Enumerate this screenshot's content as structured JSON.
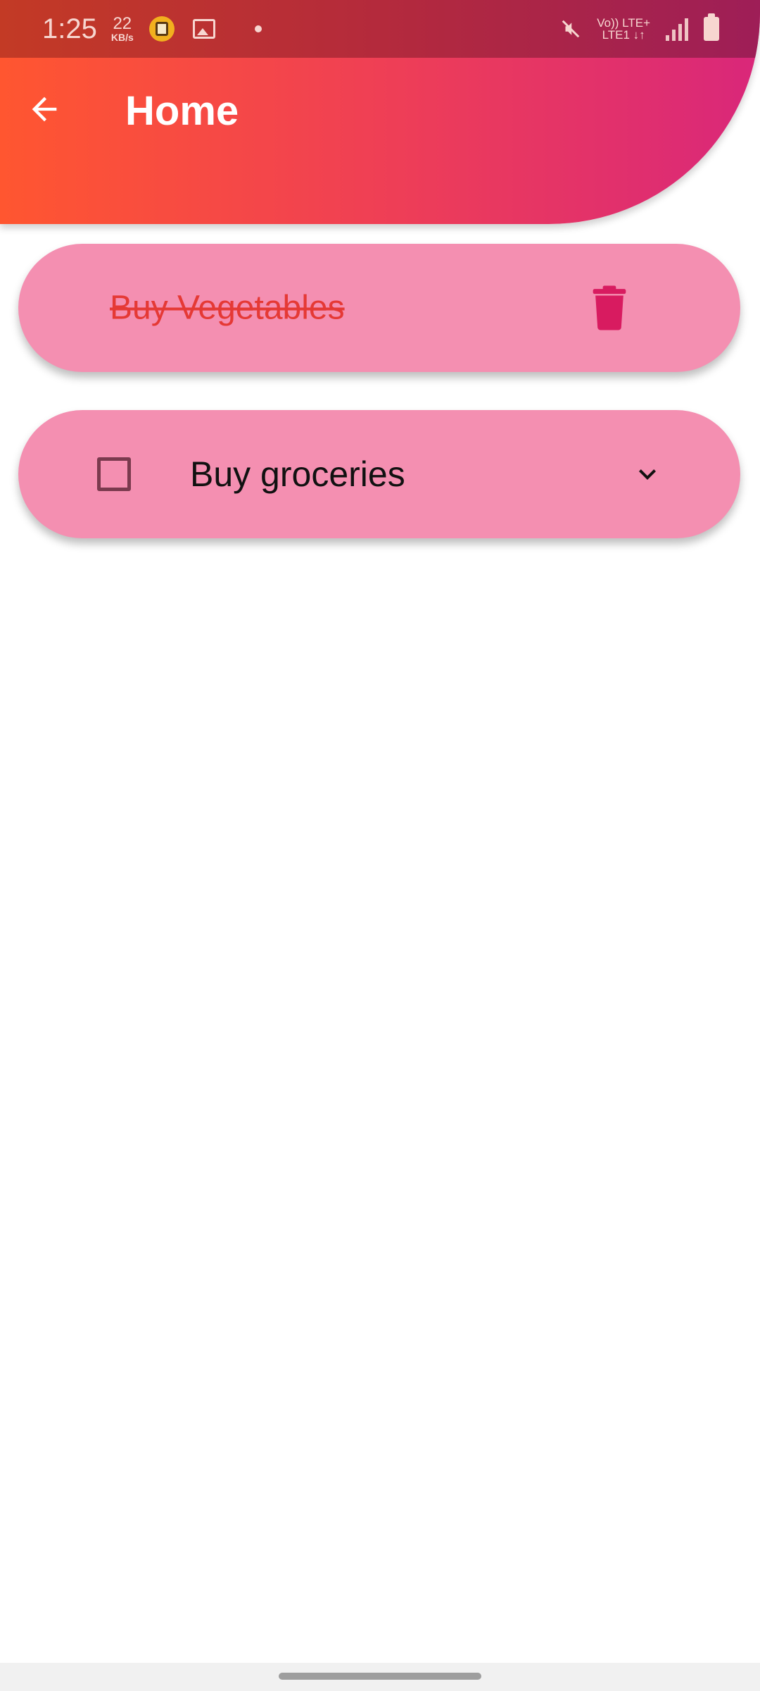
{
  "status_bar": {
    "time": "1:25",
    "speed_value": "22",
    "speed_unit": "KB/s",
    "volte_top": "Vo)) LTE+",
    "volte_bottom": "LTE1 ↓↑",
    "icons": [
      "app-notification-icon",
      "gallery-icon",
      "dot-icon",
      "mute-icon",
      "signal-icon",
      "battery-icon"
    ]
  },
  "app_bar": {
    "title": "Home",
    "back_icon": "arrow-left-icon"
  },
  "tasks": [
    {
      "label": "Buy Vegetables",
      "completed": true,
      "action_icon": "trash-icon"
    },
    {
      "label": "Buy groceries",
      "completed": false,
      "action_icon": "chevron-down-icon"
    }
  ],
  "colors": {
    "header_gradient_start": "#ff5630",
    "header_gradient_end": "#d9277a",
    "card_bg": "#f48fb1",
    "completed_text": "#e53935",
    "trash": "#d81b60"
  }
}
